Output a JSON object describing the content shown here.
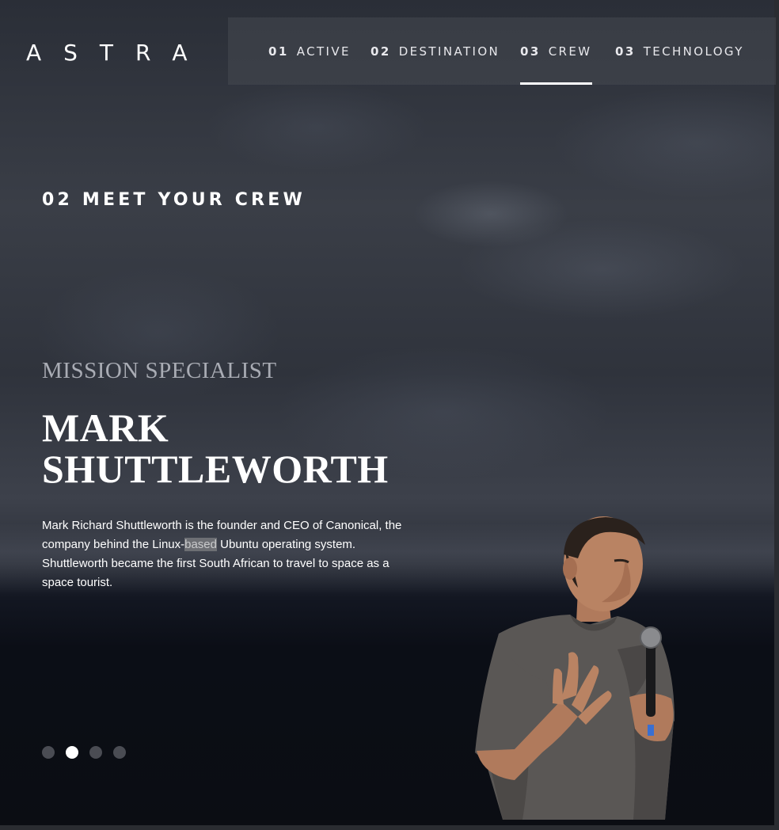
{
  "brand": {
    "logo": "ASTRA"
  },
  "nav": {
    "items": [
      {
        "num": "01",
        "label": "ACTIVE"
      },
      {
        "num": "02",
        "label": "DESTINATION"
      },
      {
        "num": "03",
        "label": "CREW"
      },
      {
        "num": "03",
        "label": "TECHNOLOGY"
      }
    ],
    "active_index": 2
  },
  "crew": {
    "section_title": "02 MEET YOUR CREW",
    "role": "MISSION SPECIALIST",
    "name_line1": "MARK",
    "name_line2": "SHUTTLEWORTH",
    "bio_part1": "Mark Richard Shuttleworth is the founder and CEO of Canonical, the company behind the Linux-",
    "bio_highlight": "based",
    "bio_part2": " Ubuntu operating system. Shuttleworth became the first South African to travel to space as a space tourist."
  },
  "pagination": {
    "count": 4,
    "active_index": 1
  },
  "colors": {
    "background": "#0b0d13",
    "nav_background": "#46484f",
    "text_primary": "#ffffff",
    "text_muted": "#a9acb4",
    "dot_inactive": "#4a4c53"
  }
}
